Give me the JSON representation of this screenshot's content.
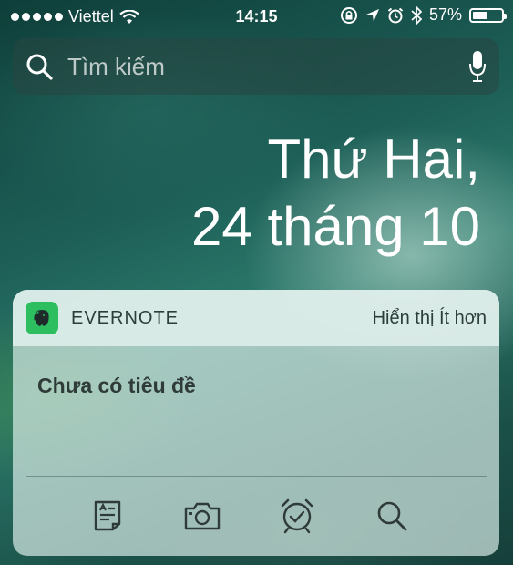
{
  "status_bar": {
    "carrier": "Viettel",
    "time": "14:15",
    "battery_percent": "57%",
    "battery_level": 0.57,
    "icons": [
      "signal-dots",
      "wifi-icon",
      "rotation-lock-icon",
      "location-icon",
      "alarm-icon",
      "bluetooth-icon",
      "battery-icon"
    ]
  },
  "search": {
    "placeholder": "Tìm kiếm"
  },
  "date": {
    "weekday": "Thứ Hai,",
    "day_month": "24 tháng 10"
  },
  "widget": {
    "app_name": "EVERNOTE",
    "show_less": "Hiển thị Ít hơn",
    "note_title": "Chưa có tiêu đề",
    "actions": [
      "new-note-icon",
      "camera-icon",
      "reminder-icon",
      "search-icon"
    ],
    "icon_color": "#2dbe60"
  }
}
